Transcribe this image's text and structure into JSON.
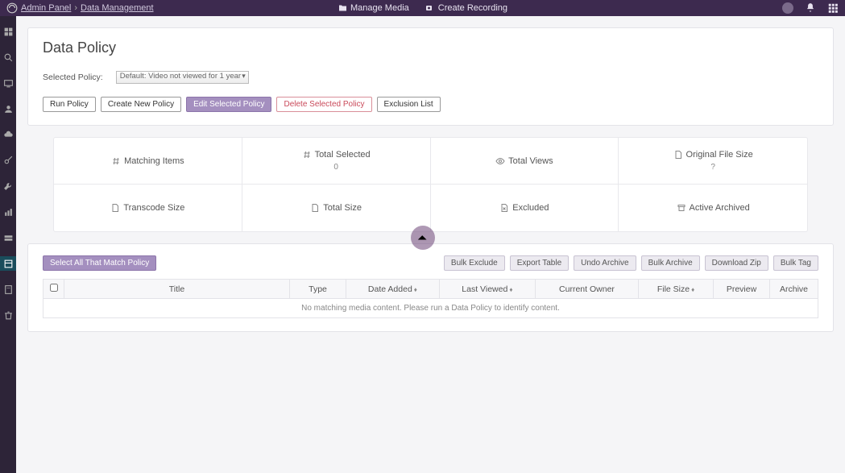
{
  "breadcrumb": {
    "root": "Admin Panel",
    "current": "Data Management"
  },
  "topnav": {
    "manage_media": "Manage Media",
    "create_recording": "Create Recording"
  },
  "page": {
    "title": "Data Policy"
  },
  "policy": {
    "label": "Selected Policy:",
    "selected": "Default: Video not viewed for 1 year"
  },
  "buttons": {
    "run": "Run Policy",
    "create": "Create New Policy",
    "edit": "Edit Selected Policy",
    "delete": "Delete Selected Policy",
    "exclusion": "Exclusion List"
  },
  "stats": {
    "matching": "Matching Items",
    "total_selected": "Total Selected",
    "total_selected_val": "0",
    "total_views": "Total Views",
    "original_size": "Original File Size",
    "original_size_val": "?",
    "transcode_size": "Transcode Size",
    "total_size": "Total Size",
    "excluded": "Excluded",
    "active_archived": "Active Archived"
  },
  "table_buttons": {
    "select_all": "Select All That Match Policy",
    "bulk_exclude": "Bulk Exclude",
    "export_table": "Export Table",
    "undo_archive": "Undo Archive",
    "bulk_archive": "Bulk Archive",
    "download_zip": "Download Zip",
    "bulk_tag": "Bulk Tag"
  },
  "columns": {
    "title": "Title",
    "type": "Type",
    "date_added": "Date Added",
    "last_viewed": "Last Viewed",
    "current_owner": "Current Owner",
    "file_size": "File Size",
    "preview": "Preview",
    "archive": "Archive"
  },
  "empty_msg": "No matching media content. Please run a Data Policy to identify content."
}
